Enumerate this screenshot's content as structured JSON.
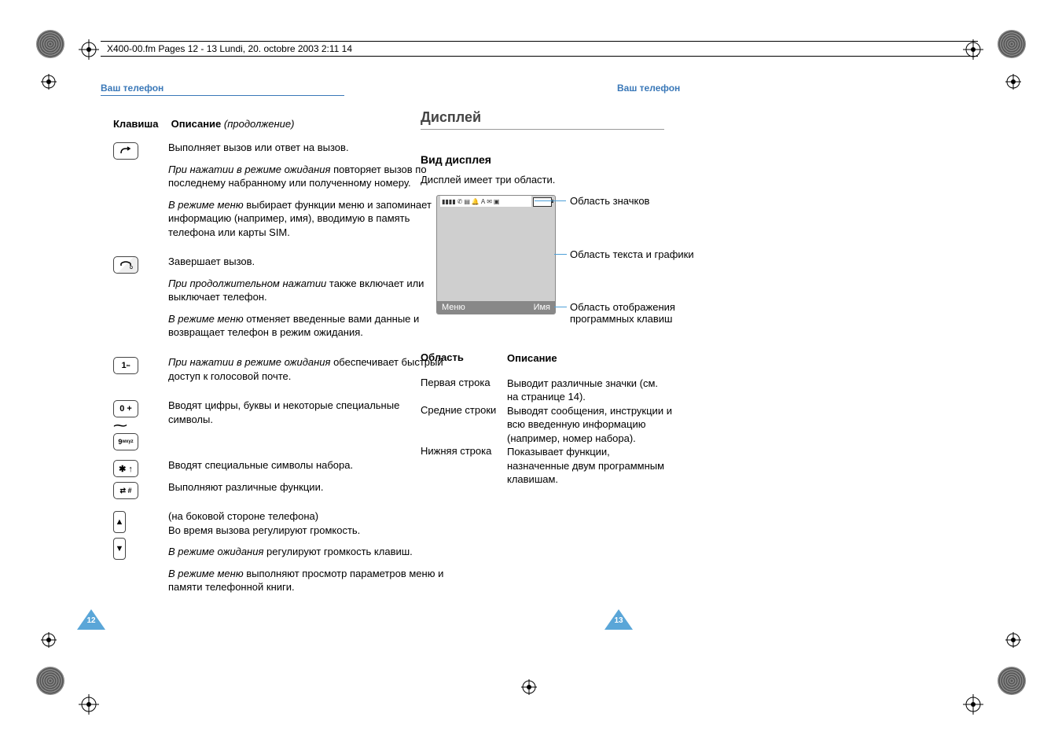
{
  "header_line": "X400-00.fm  Pages 12 - 13  Lundi, 20. octobre 2003  2:11 14",
  "left": {
    "section": "Ваш телефон",
    "col_key": "Клавиша",
    "col_desc": "Описание",
    "continuation": "(продолжение)",
    "rows": [
      {
        "icon_id": "call-key",
        "paras": [
          {
            "text": "Выполняет вызов или ответ на вызов."
          },
          {
            "lead_italic": "При нажатии в режиме ожидания",
            "rest": " повторяет вызов по последнему набранному или полученному номеру."
          },
          {
            "lead_italic": "В режиме меню",
            "rest": " выбирает функции меню и запоминает информацию (например, имя), вводимую в память телефона или карты SIM."
          }
        ]
      },
      {
        "icon_id": "end-key",
        "paras": [
          {
            "text": "Завершает вызов."
          },
          {
            "lead_italic": "При продолжительном нажатии",
            "rest": " также включает или выключает телефон."
          },
          {
            "lead_italic": "В режиме меню",
            "rest": " отменяет введенные вами данные и возвращает телефон в режим ожидания."
          }
        ]
      },
      {
        "icon_id": "one-key",
        "paras": [
          {
            "lead_italic": "При нажатии в режиме ожидания",
            "rest": " обеспечивает быстрый доступ к голосовой почте."
          }
        ]
      },
      {
        "icon_id": "digit-keys",
        "paras": [
          {
            "text": "Вводят цифры, буквы и некоторые специальные символы."
          }
        ]
      },
      {
        "icon_id": "star-hash-keys",
        "paras": [
          {
            "text": "Вводят специальные символы набора."
          },
          {
            "text": "Выполняют различные функции."
          }
        ]
      },
      {
        "icon_id": "volume-keys",
        "paras": [
          {
            "text": "(на боковой стороне телефона)\nВо время вызова регулируют громкость."
          },
          {
            "lead_italic": "В режиме ожидания",
            "rest": " регулируют громкость клавиш."
          },
          {
            "lead_italic": "В режиме меню",
            "rest": " выполняют просмотр параметров меню и памяти телефонной книги."
          }
        ]
      }
    ],
    "page_num": "12"
  },
  "right": {
    "section": "Ваш телефон",
    "title": "Дисплей",
    "subtitle": "Вид дисплея",
    "intro": "Дисплей имеет три области.",
    "screen": {
      "softkey_left": "Меню",
      "softkey_right": "Имя"
    },
    "callouts": {
      "icons": "Область значков",
      "text_graphics": "Область текста и графики",
      "softkeys": "Область отображения программных клавиш"
    },
    "table": {
      "col_area": "Область",
      "col_desc": "Описание",
      "rows": [
        {
          "area": "Первая строка",
          "desc": "Выводит различные значки (см. на странице 14)."
        },
        {
          "area": "Средние строки",
          "desc": "Выводят сообщения, инструкции и всю введенную информацию (например, номер набора)."
        },
        {
          "area": "Нижняя строка",
          "desc": "Показывает функции, назначенные двум программным клавишам."
        }
      ]
    },
    "page_num": "13"
  }
}
